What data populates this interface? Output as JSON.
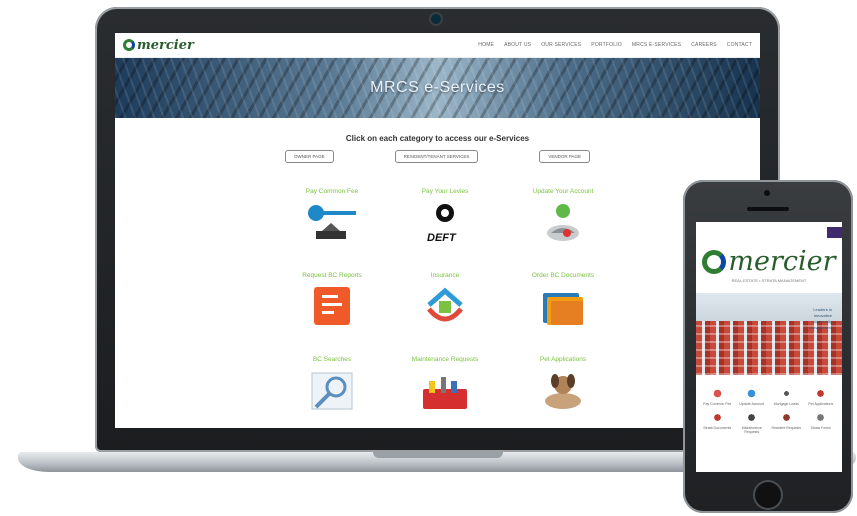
{
  "laptop": {
    "logo_text": "mercier",
    "nav": [
      "HOME",
      "ABOUT US",
      "OUR SERVICES",
      "PORTFOLIO",
      "MRCS E-SERVICES",
      "CAREERS",
      "CONTACT"
    ],
    "hero_title": "MRCS e-Services",
    "tagline": "Click on each category to access our e-Services",
    "categories": [
      "OWNER PAGE",
      "RESIDENT/TENANT SERVICES",
      "VENDOR PAGE"
    ],
    "services": [
      {
        "label": "Pay Common Fee",
        "icon": "key-card-icon"
      },
      {
        "label": "Pay Your Levies",
        "icon": "deft-payment-icon"
      },
      {
        "label": "Update Your Account",
        "icon": "mouse-update-icon"
      },
      {
        "label": "Request BC Reports",
        "icon": "report-document-icon"
      },
      {
        "label": "Insurance",
        "icon": "house-insurance-icon"
      },
      {
        "label": "Order BC Documents",
        "icon": "folders-icon"
      },
      {
        "label": "BC Searches",
        "icon": "search-magnifier-icon"
      },
      {
        "label": "Maintenance Requests",
        "icon": "toolbox-icon"
      },
      {
        "label": "Pet Applications",
        "icon": "dog-pet-icon"
      }
    ]
  },
  "phone": {
    "logo_text": "mercier",
    "subtitle": "REAL ESTATE • STRATA MANAGEMENT",
    "hero_text": [
      "Leaders in",
      "innovative",
      "community",
      "management"
    ],
    "services": [
      {
        "label": "Pay Common Fee",
        "icon": "coins-icon"
      },
      {
        "label": "Update Account",
        "icon": "mail-icon"
      },
      {
        "label": "Mortgage Leads",
        "icon": "network-icon"
      },
      {
        "label": "Pet Applications",
        "icon": "paw-icon"
      },
      {
        "label": "Strata Documents",
        "icon": "document-stack-icon"
      },
      {
        "label": "Maintenance Requests",
        "icon": "tools-icon"
      },
      {
        "label": "Resident Requests",
        "icon": "people-icon"
      },
      {
        "label": "Strata Forms",
        "icon": "form-icon"
      }
    ]
  },
  "colors": {
    "accent_green": "#7cc142",
    "brand_green": "#2e7d32",
    "brand_blue": "#0d47a1"
  }
}
